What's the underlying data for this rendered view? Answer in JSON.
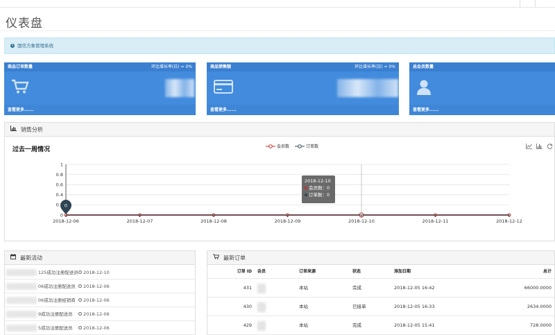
{
  "page_title": "仪表盘",
  "alert": {
    "text": "国信万象管理系统"
  },
  "stats": [
    {
      "title": "商品订单数量",
      "growth": "环比增长率(日) ≈ 0%",
      "more": "查看更多......",
      "icon": "shopping-cart-icon"
    },
    {
      "title": "商品销售额",
      "growth": "环比增长率(日) ≈ 0%",
      "more": "查看更多......",
      "icon": "credit-card-icon"
    },
    {
      "title": "总会员数量",
      "growth": "",
      "more": "查看更多......",
      "icon": "user-icon"
    }
  ],
  "sales": {
    "panel_title": "销售分析",
    "chart_title": "过去一周情况",
    "legend": [
      "会员数",
      "订单数"
    ],
    "tooltip": {
      "date": "2018-12-10",
      "lines": [
        "会员数：0",
        "订单数：0"
      ]
    }
  },
  "chart_data": {
    "type": "line",
    "title": "过去一周情况",
    "categories": [
      "2018-12-06",
      "2018-12-07",
      "2018-12-08",
      "2018-12-09",
      "2018-12-10",
      "2018-12-11",
      "2018-12-12"
    ],
    "y_ticks": [
      "0",
      "0.2",
      "0.4",
      "0.6",
      "0.8",
      "1"
    ],
    "ylim": [
      0,
      1
    ],
    "series": [
      {
        "name": "会员数",
        "values": [
          0,
          0,
          0,
          0,
          0,
          0,
          0
        ],
        "color": "#c23531"
      },
      {
        "name": "订单数",
        "values": [
          0,
          0,
          0,
          0,
          0,
          0,
          0
        ],
        "color": "#2f4554"
      }
    ],
    "marker_label": "0",
    "grid": true,
    "legend_position": "top-center"
  },
  "activity": {
    "panel_title": "最新活动",
    "items": [
      {
        "text": "125成功注册配送员",
        "date": "2018-12-10"
      },
      {
        "text": "06成功注册配送员",
        "date": "2018-12-06"
      },
      {
        "text": "06成功注册经销商",
        "date": "2018-12-06"
      },
      {
        "text": "9成功注册配送员",
        "date": "2018-12-06"
      },
      {
        "text": "5成功注册配送员",
        "date": "2018-12-06"
      }
    ]
  },
  "orders": {
    "panel_title": "最新订单",
    "headers": {
      "id": "订单 ID",
      "member": "会员",
      "source": "订单来源",
      "status": "状态",
      "date": "添加日期",
      "total": "总计"
    },
    "rows": [
      {
        "id": "431",
        "source": "本站",
        "status": "完成",
        "date": "2018-12-05 16:42",
        "total": "66000.0000"
      },
      {
        "id": "430",
        "source": "本站",
        "status": "已接单",
        "date": "2018-12-05 16:33",
        "total": "2634.0000"
      },
      {
        "id": "429",
        "source": "本站",
        "status": "完成",
        "date": "2018-12-05 15:41",
        "total": "728.0000"
      }
    ]
  }
}
